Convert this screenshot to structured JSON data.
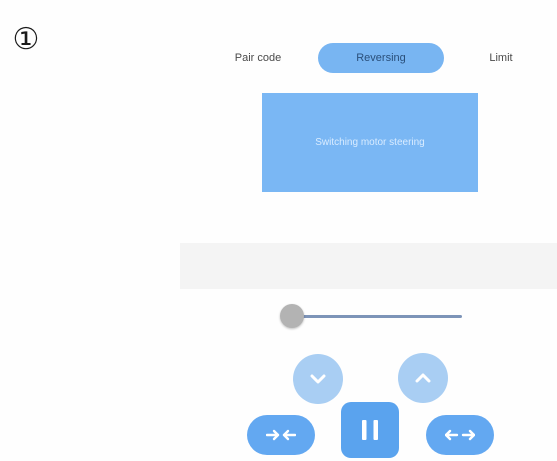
{
  "step_marker": "①",
  "tabs": [
    {
      "label": "Pair code",
      "selected": false
    },
    {
      "label": "Reversing",
      "selected": true
    },
    {
      "label": "Limit",
      "selected": false
    }
  ],
  "action_button": {
    "label": "Switching motor steering"
  },
  "slider": {
    "value_fraction": 0.0
  },
  "controls": {
    "down_icon": "chevron-down-icon",
    "up_icon": "chevron-up-icon",
    "inward_icon": "arrows-inward-icon",
    "pause_icon": "pause-icon",
    "outward_icon": "arrows-outward-icon"
  },
  "colors": {
    "accent": "#78b5f2",
    "action_box": "#7ab7f4",
    "light_button": "#a9cef3",
    "strong_button": "#5aa3ee",
    "slider_track": "#7d94b8",
    "slider_thumb": "#b3b3b3",
    "gray_band": "#f4f4f4"
  }
}
